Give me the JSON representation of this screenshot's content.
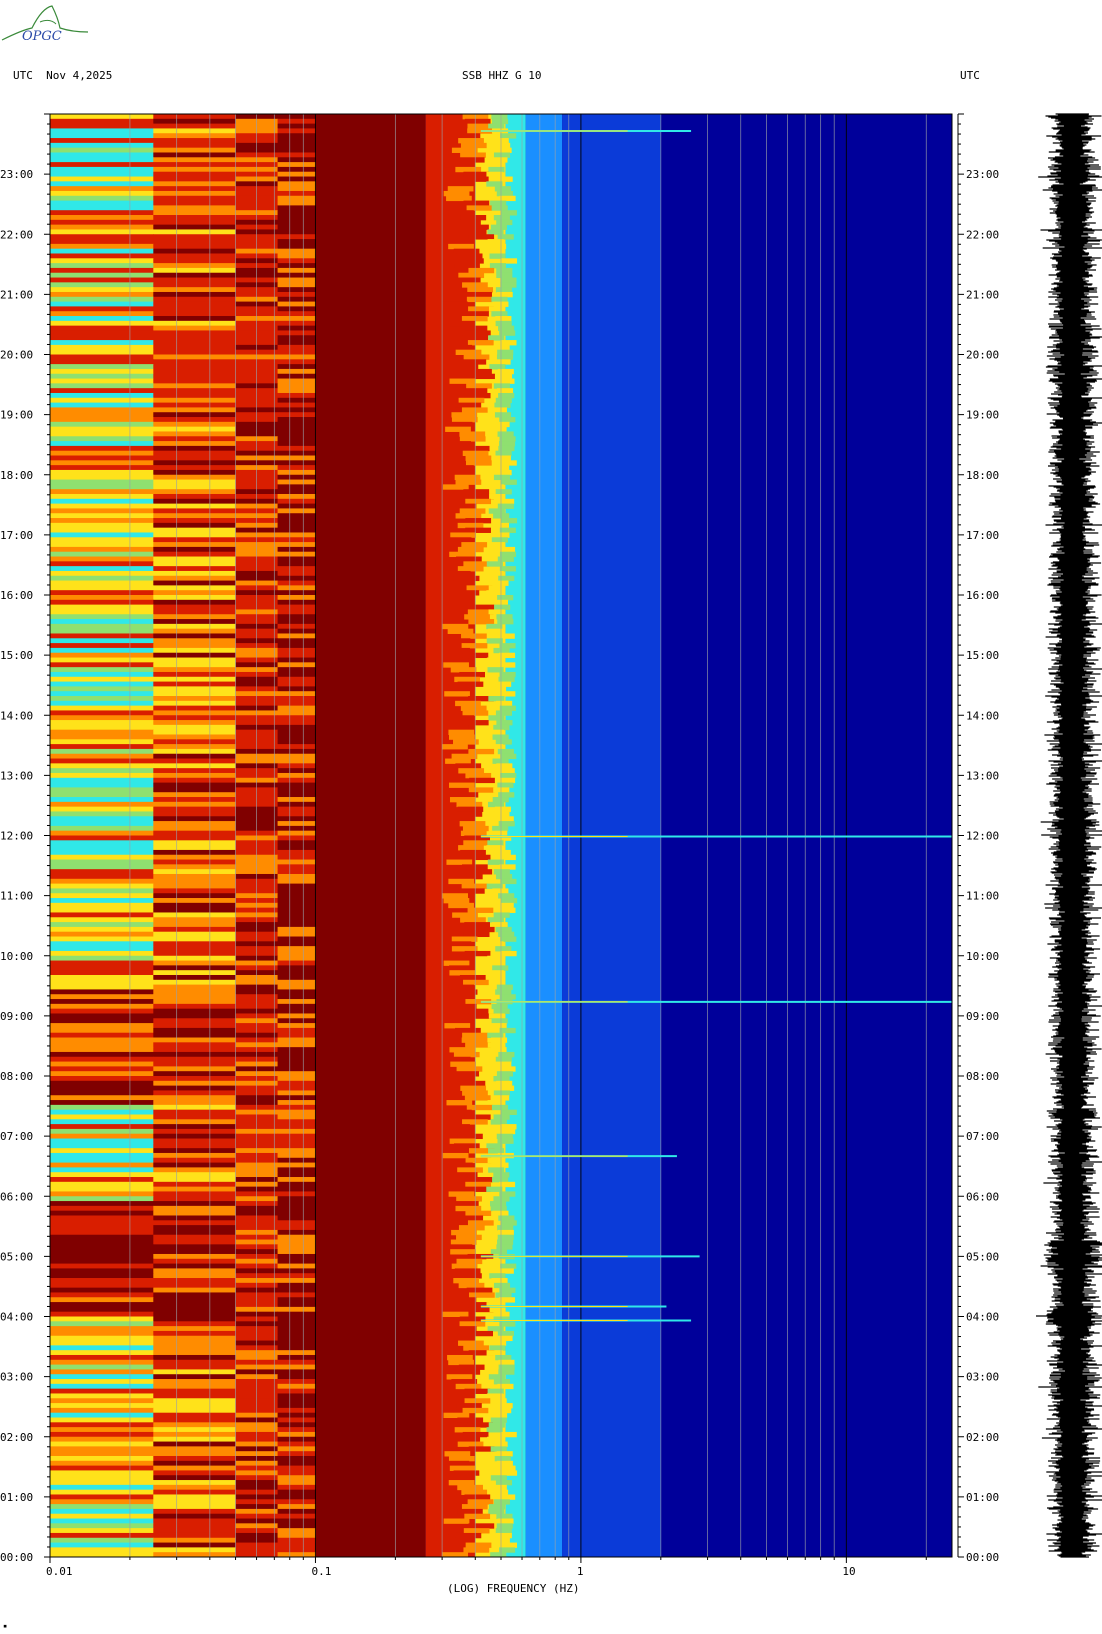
{
  "header": {
    "left": "UTC  Nov 4,2025",
    "center": "SSB HHZ G 10",
    "right": "UTC"
  },
  "logo": {
    "text": "OPGC",
    "accent": "#3a8a3a"
  },
  "colors": {
    "deep_red": "#800000",
    "red": "#d91e00",
    "orange": "#ff8c00",
    "yellow": "#ffe21a",
    "green": "#8fe070",
    "cyan": "#30e8e8",
    "light_blue": "#1a8fff",
    "blue": "#0b3bd8",
    "navy": "#00009a"
  },
  "chart_data": {
    "type": "heatmap",
    "title": "SSB HHZ G 10",
    "xlabel": "(LOG) FREQUENCY (HZ)",
    "x_scale": "log",
    "xlim": [
      0.01,
      25
    ],
    "x_ticks": [
      {
        "value": 0.01,
        "label": "0.01"
      },
      {
        "value": 0.1,
        "label": "0.1"
      },
      {
        "value": 1,
        "label": "1"
      },
      {
        "value": 10,
        "label": "10"
      }
    ],
    "y_ticks": [
      "23:00",
      "22:00",
      "21:00",
      "20:00",
      "19:00",
      "18:00",
      "17:00",
      "16:00",
      "15:00",
      "14:00",
      "13:00",
      "12:00",
      "11:00",
      "10:00",
      "09:00",
      "08:00",
      "07:00",
      "06:00",
      "05:00",
      "04:00",
      "03:00",
      "02:00",
      "01:00",
      "00:00"
    ],
    "ylim_hours": [
      0,
      24
    ],
    "events": [
      {
        "time": "23:43",
        "fmax_hz": 2.6
      },
      {
        "time": "11:59",
        "fmax_hz": 25
      },
      {
        "time": "09:14",
        "fmax_hz": 25
      },
      {
        "time": "06:40",
        "fmax_hz": 2.3
      },
      {
        "time": "05:00",
        "fmax_hz": 2.8
      },
      {
        "time": "04:10",
        "fmax_hz": 2.1
      },
      {
        "time": "03:56",
        "fmax_hz": 2.6
      }
    ]
  }
}
